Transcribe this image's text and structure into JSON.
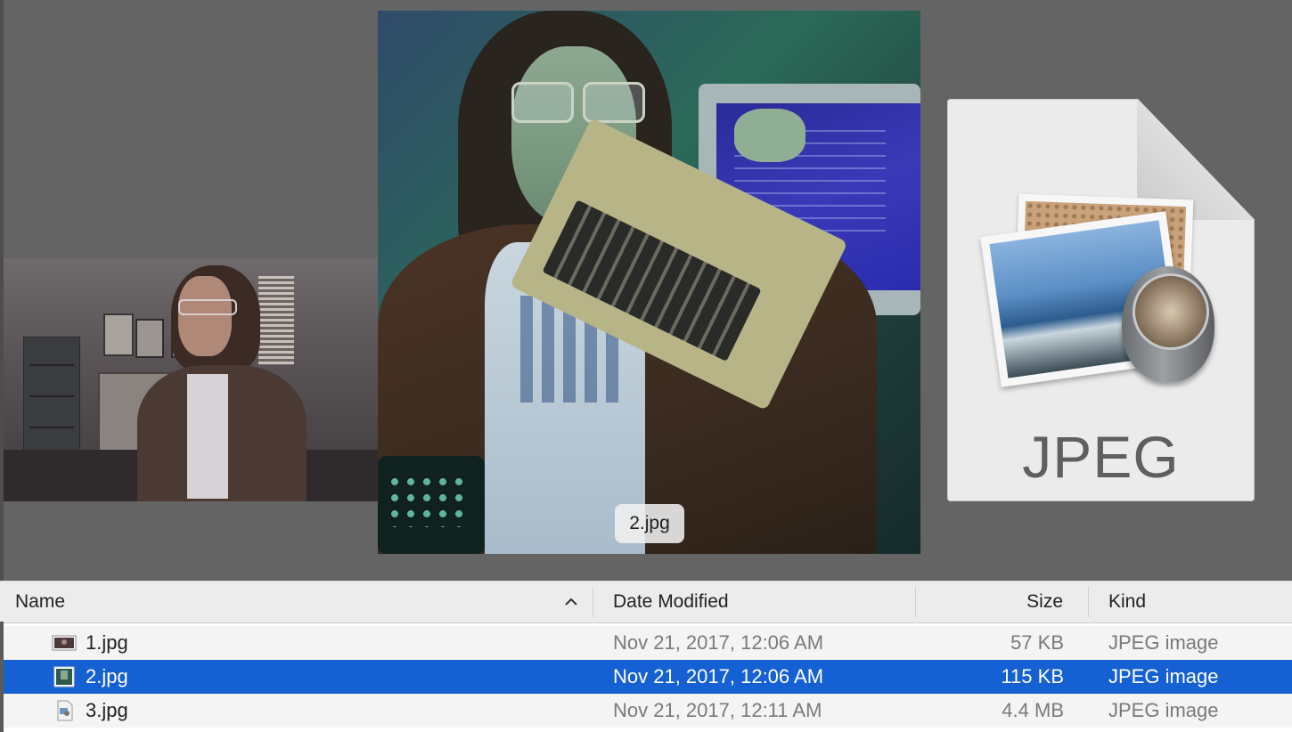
{
  "preview": {
    "caption": "2.jpg",
    "document_icon_label": "JPEG"
  },
  "list": {
    "columns": {
      "name": "Name",
      "date_modified": "Date Modified",
      "size": "Size",
      "kind": "Kind"
    },
    "sort": {
      "column": "name",
      "direction": "ascending"
    },
    "rows": [
      {
        "name": "1.jpg",
        "date": "Nov 21, 2017, 12:06 AM",
        "size": "57 KB",
        "kind": "JPEG image",
        "icon": "image-thumbnail-icon"
      },
      {
        "name": "2.jpg",
        "date": "Nov 21, 2017, 12:06 AM",
        "size": "115 KB",
        "kind": "JPEG image",
        "icon": "image-thumbnail-icon",
        "selected": true
      },
      {
        "name": "3.jpg",
        "date": "Nov 21, 2017, 12:11 AM",
        "size": "4.4 MB",
        "kind": "JPEG image",
        "icon": "jpeg-document-icon"
      }
    ]
  },
  "colors": {
    "coverflow_background": "#646464",
    "selection": "#1560d2",
    "header_background": "#ececec"
  }
}
